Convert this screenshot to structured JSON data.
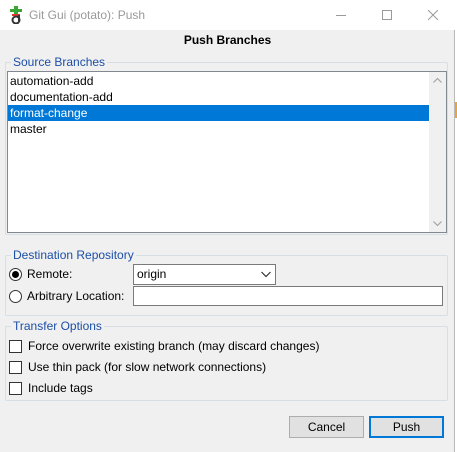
{
  "window": {
    "title": "Git Gui (potato): Push",
    "icons": {
      "app": "git-gui-icon",
      "minimize": "minimize-icon",
      "maximize": "maximize-icon",
      "close": "close-icon"
    }
  },
  "header": {
    "title": "Push Branches"
  },
  "source_branches": {
    "legend": "Source Branches",
    "items": [
      {
        "label": "automation-add",
        "selected": false
      },
      {
        "label": "documentation-add",
        "selected": false
      },
      {
        "label": "format-change",
        "selected": true
      },
      {
        "label": "master",
        "selected": false
      }
    ]
  },
  "destination": {
    "legend": "Destination Repository",
    "remote_label": "Remote:",
    "remote_value": "origin",
    "remote_checked": true,
    "arbitrary_label": "Arbitrary Location:",
    "arbitrary_value": "",
    "arbitrary_checked": false
  },
  "transfer": {
    "legend": "Transfer Options",
    "options": [
      {
        "label": "Force overwrite existing branch (may discard changes)",
        "checked": false
      },
      {
        "label": "Use thin pack (for slow network connections)",
        "checked": false
      },
      {
        "label": "Include tags",
        "checked": false
      }
    ]
  },
  "buttons": {
    "cancel": "Cancel",
    "push": "Push"
  },
  "colors": {
    "selection": "#0078d7",
    "legend": "#1c4fa6",
    "accent_border": "#0078d7"
  }
}
